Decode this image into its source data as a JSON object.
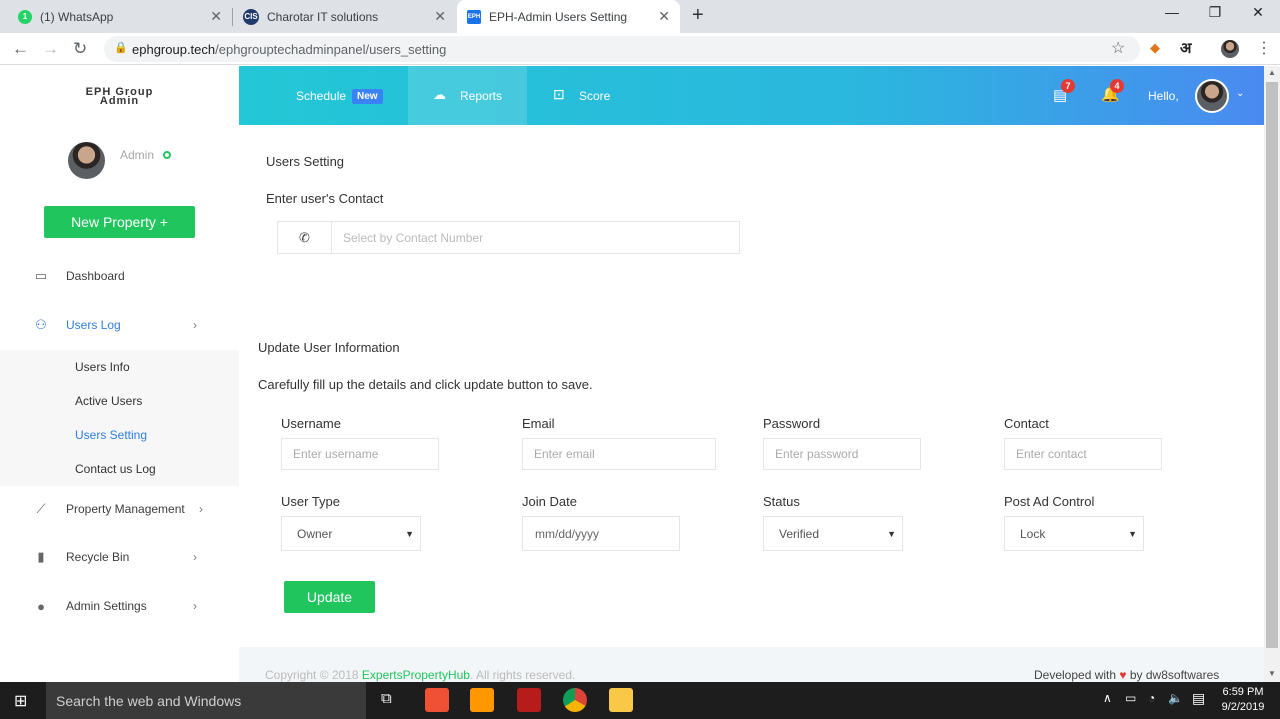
{
  "browser": {
    "tabs": [
      {
        "label": "(1) WhatsApp"
      },
      {
        "label": "Charotar IT solutions"
      },
      {
        "label": "EPH-Admin Users Setting"
      }
    ],
    "url_host": "ephgroup.tech",
    "url_path": "/ephgrouptechadminpanel/users_setting",
    "ext_text": "अ"
  },
  "sidebar": {
    "brand_line1": "EPH Group",
    "brand_line2": "Admin",
    "admin_label": "Admin",
    "new_property": "New Property +",
    "items": [
      {
        "label": "Dashboard"
      },
      {
        "label": "Users Log"
      },
      {
        "label": "Property Management"
      },
      {
        "label": "Recycle Bin"
      },
      {
        "label": "Admin Settings"
      }
    ],
    "subitems": [
      {
        "label": "Users Info"
      },
      {
        "label": "Active Users"
      },
      {
        "label": "Users Setting"
      },
      {
        "label": "Contact us Log"
      }
    ]
  },
  "header": {
    "schedule": "Schedule",
    "new_badge": "New",
    "reports": "Reports",
    "score": "Score",
    "docs_count": "7",
    "bell_count": "4",
    "hello": "Hello,"
  },
  "users_setting": {
    "title": "Users Setting",
    "contact_label": "Enter user's Contact",
    "contact_placeholder": "Select by Contact Number"
  },
  "update_info": {
    "title": "Update User Information",
    "subtitle": "Carefully fill up the details and click update button to save.",
    "username_label": "Username",
    "username_placeholder": "Enter username",
    "email_label": "Email",
    "email_placeholder": "Enter email",
    "password_label": "Password",
    "password_placeholder": "Enter password",
    "contact_label": "Contact",
    "contact_placeholder": "Enter contact",
    "usertype_label": "User Type",
    "usertype_value": "Owner",
    "joindate_label": "Join Date",
    "joindate_placeholder": "mm/dd/yyyy",
    "status_label": "Status",
    "status_value": "Verified",
    "postad_label": "Post Ad Control",
    "postad_value": "Lock",
    "update_button": "Update"
  },
  "footer": {
    "copyright_pre": "Copyright © 2018",
    "copyright_link": "ExpertsPropertyHub",
    "copyright_post": ". All rights reserved.",
    "developed_pre": "Developed with",
    "developed_post": "by dw8softwares"
  },
  "taskbar": {
    "search_placeholder": "Search the web and Windows",
    "time": "6:59 PM",
    "date": "9/2/2019"
  },
  "colors": {
    "accent_green": "#21c55d",
    "header_start": "#23c7d6",
    "header_end": "#4a8af0",
    "badge_red": "#e53935"
  }
}
